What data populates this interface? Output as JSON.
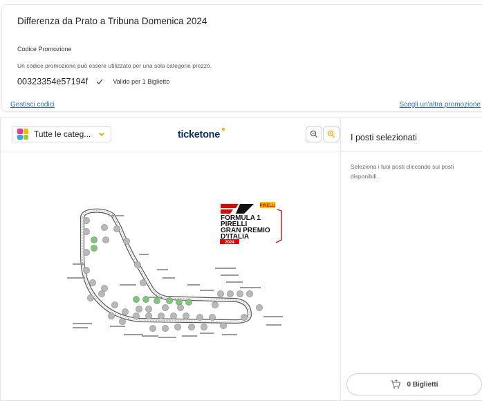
{
  "promo": {
    "title": "Differenza da Prato a Tribuna Domenica 2024",
    "code_label": "Codice Promozione",
    "help_text": "Un codice promozione può essere utilizzato per una sola categorie prezzo.",
    "code": "00323354e57194f",
    "valid_text": "Valido per 1 Biglietto",
    "manage_link": "Gestisci codici",
    "other_link": "Scegli un'altra promozione"
  },
  "map": {
    "category_select": "Tutte le categ...",
    "brand": "ticketone",
    "poster": {
      "badge": "PIRELLI",
      "lines": [
        "FORMULA 1",
        "PIRELLI",
        "GRAN PREMIO",
        "D'ITALIA"
      ],
      "year": "2024"
    }
  },
  "seats": {
    "title": "I posti selezionati",
    "help_text": "Seleziona i tuoi posti cliccando sui posti disponibili.",
    "tickets_button": "0 Biglietti"
  },
  "colors": {
    "link": "#2a6fb0",
    "brand": "#0c2f6b",
    "zoom_in_accent": "#f3a800",
    "available_seat": "#7dc67a",
    "unavailable_seat": "#b9b9b9",
    "f1_red": "#e10600"
  },
  "icons": [
    "check-icon",
    "chevron-down-icon",
    "zoom-out-icon",
    "zoom-in-icon",
    "cart-icon",
    "category-grid-icon"
  ]
}
